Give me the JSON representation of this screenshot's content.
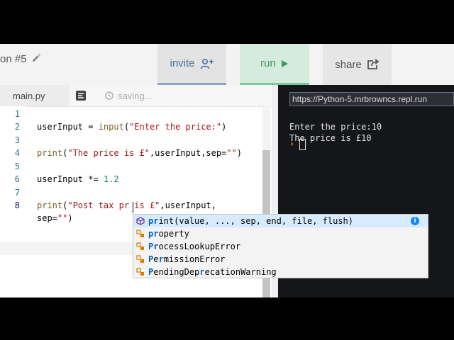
{
  "header": {
    "project_name": "on #5",
    "invite_label": "invite",
    "run_label": "run",
    "share_label": "share"
  },
  "editor": {
    "file_tab": "main.py",
    "status": "saving...",
    "line_numbers": [
      "1",
      "2",
      "3",
      "4",
      "5",
      "6",
      "7",
      "8"
    ],
    "lines": {
      "l2_a": "userInput = ",
      "l2_fn": "input",
      "l2_b": "(",
      "l2_str": "\"Enter the price:\"",
      "l2_c": ")",
      "l4_fn": "print",
      "l4_a": "(",
      "l4_str": "\"The price is £\"",
      "l4_b": ",userInput,sep=",
      "l4_str2": "\"\"",
      "l4_c": ")",
      "l6_a": "userInput *= ",
      "l6_num": "1.2",
      "l8_fn": "print",
      "l8_a": "(",
      "l8_str": "\"Post tax pr is £\"",
      "l8_b": ",userInput,",
      "l8w_a": "sep=",
      "l8w_str": "\"\"",
      "l8w_b": ")"
    }
  },
  "autocomplete": {
    "items": [
      {
        "match": "pr",
        "rest": "int(value, ..., sep, end, file, flush)",
        "icon": "function-cube-icon"
      },
      {
        "match": "pr",
        "rest": "operty",
        "icon": "class-icon"
      },
      {
        "pre": "",
        "match": "Pr",
        "rest": "ocessLookupError",
        "icon": "class-icon"
      },
      {
        "pre": "",
        "match": "P",
        "mid": "e",
        "match2": "r",
        "rest": "missionError",
        "icon": "class-icon"
      },
      {
        "pre": "",
        "match": "P",
        "mid": "endingDep",
        "match2": "r",
        "rest": "ecationWarning",
        "icon": "class-icon"
      }
    ]
  },
  "console": {
    "url": "https://Python-5.mrbrowncs.repl.run",
    "output": [
      "Enter the price:10",
      "The price is £10"
    ],
    "prompt": "›"
  },
  "colors": {
    "run_green": "#3a9b62",
    "invite_blue": "#4a6fa0",
    "console_bg": "#15161a",
    "prompt_orange": "#f08a24"
  }
}
